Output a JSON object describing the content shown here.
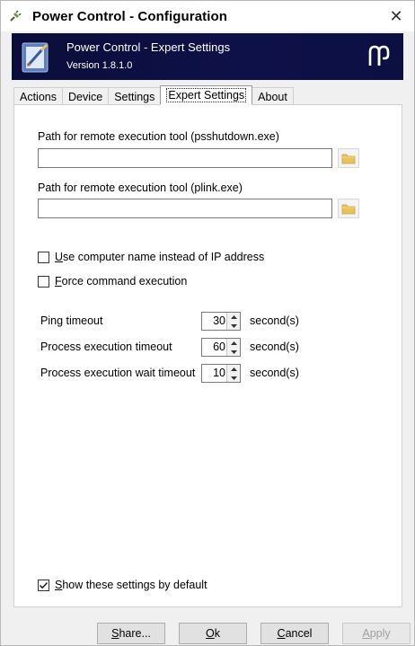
{
  "window": {
    "title": "Power Control - Configuration",
    "close_glyph": "✕"
  },
  "banner": {
    "title": "Power Control - Expert Settings",
    "version": "Version 1.8.1.0"
  },
  "tabs": [
    {
      "label": "Actions",
      "active": false
    },
    {
      "label": "Device",
      "active": false
    },
    {
      "label": "Settings",
      "active": false
    },
    {
      "label": "Expert Settings",
      "active": true
    },
    {
      "label": "About",
      "active": false
    }
  ],
  "expert": {
    "psshutdown_label": "Path for remote execution tool (psshutdown.exe)",
    "psshutdown_value": "",
    "plink_label": "Path for remote execution tool (plink.exe)",
    "plink_value": "",
    "use_computer_name": {
      "prefix": "U",
      "rest": "se computer name instead of IP address",
      "checked": false
    },
    "force_command": {
      "prefix": "F",
      "rest": "orce command execution",
      "checked": false
    },
    "ping_timeout": {
      "label": "Ping timeout",
      "value": "30",
      "unit": "second(s)"
    },
    "process_timeout": {
      "label": "Process execution timeout",
      "value": "60",
      "unit": "second(s)"
    },
    "wait_timeout": {
      "label": "Process execution wait timeout",
      "value": "10",
      "unit": "second(s)"
    },
    "show_default": {
      "prefix": "S",
      "rest": "how these settings by default",
      "checked": true
    }
  },
  "footer": {
    "share": {
      "prefix": "S",
      "rest": "hare..."
    },
    "ok": {
      "prefix": "O",
      "rest": "k"
    },
    "cancel": {
      "prefix": "C",
      "rest": "ancel"
    },
    "apply": {
      "prefix": "A",
      "rest": "pply"
    }
  },
  "icons": {
    "app": "power-plug-icon",
    "banner": "settings-document-icon",
    "logo": "brand-logo-icon",
    "folder": "folder-icon"
  },
  "colors": {
    "banner_bg": "#0b0d3a",
    "folder": "#e8c25a"
  }
}
